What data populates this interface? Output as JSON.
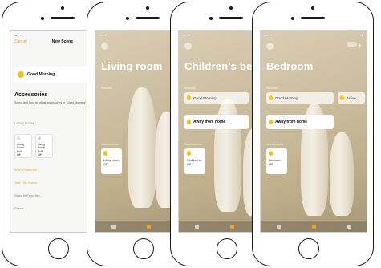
{
  "phone1": {
    "status_left": "•••• ᯤ",
    "status_right": "▮",
    "nav_cancel": "Cancel",
    "nav_title": "New Scene",
    "scene_name": "Good Morning",
    "accessories_heading": "Accessories",
    "accessories_desc": "Select and hold to adjust accessories in \"Good Morning\" scene.",
    "group_label": "LIVING ROOM",
    "accessories": [
      {
        "name": "Living Room Bulb",
        "state": "Off"
      },
      {
        "name": "Living Room Bulb",
        "state": "Off"
      }
    ],
    "add_link": "Add or Remove...",
    "test_link": "Test This Scene",
    "favorites_label": "Show in Favorites",
    "tab_label": "Scene"
  },
  "phone2": {
    "status_left": "•••• ᯤ",
    "status_right": "▮",
    "room_title": "Living room",
    "scenes_label": "Scenes",
    "accessories_label": "Accessories",
    "accessory": {
      "name": "Living room",
      "state": "Off"
    }
  },
  "phone3": {
    "status_left": "•••• ᯤ",
    "status_right": "▮",
    "room_title": "Children's be",
    "scenes_label": "Scenes",
    "scene_top": "Good Morning",
    "scene_main": "Away from home",
    "accessories_label": "Accessories",
    "accessory": {
      "name": "Children's...",
      "state": "Off"
    }
  },
  "phone4": {
    "status_left": "•••• ᯤ",
    "status_right": "▮",
    "room_title": "Bedroom",
    "scenes_label": "Scenes",
    "scene_top": "Good Morning",
    "scene_top2": "Arrive",
    "scene_main": "Away from home",
    "accessories_label": "Accessories",
    "accessory": {
      "name": "Bedroom",
      "state": "Off"
    }
  }
}
